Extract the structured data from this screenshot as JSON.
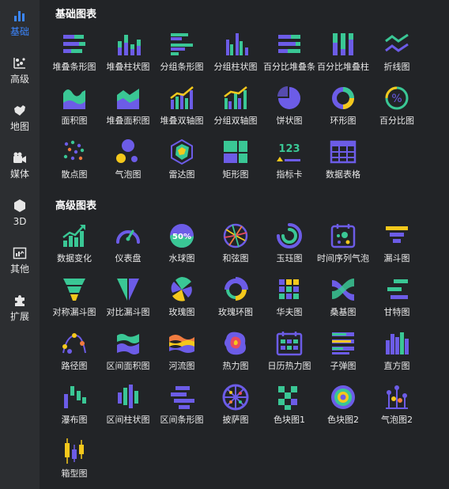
{
  "sidebar": {
    "items": [
      {
        "label": "基础",
        "icon": "bar-chart-icon",
        "active": true
      },
      {
        "label": "高级",
        "icon": "scatter-icon"
      },
      {
        "label": "地图",
        "icon": "map-icon"
      },
      {
        "label": "媒体",
        "icon": "camera-icon"
      },
      {
        "label": "3D",
        "icon": "cube-icon"
      },
      {
        "label": "其他",
        "icon": "image-chart-icon"
      },
      {
        "label": "扩展",
        "icon": "puzzle-icon"
      }
    ]
  },
  "sections": {
    "basic": {
      "title": "基础图表",
      "items": [
        "堆叠条形图",
        "堆叠柱状图",
        "分组条形图",
        "分组柱状图",
        "百分比堆叠条",
        "百分比堆叠柱",
        "折线图",
        "面积图",
        "堆叠面积图",
        "堆叠双轴图",
        "分组双轴图",
        "饼状图",
        "环形图",
        "百分比图",
        "散点图",
        "气泡图",
        "雷达图",
        "矩形图",
        "指标卡",
        "数据表格"
      ]
    },
    "advanced": {
      "title": "高级图表",
      "items": [
        "数据变化",
        "仪表盘",
        "水球图",
        "和弦图",
        "玉珏图",
        "时间序列气泡",
        "漏斗图",
        "对称漏斗图",
        "对比漏斗图",
        "玫瑰图",
        "玫瑰环图",
        "华夫图",
        "桑基图",
        "甘特图",
        "路径图",
        "区间面积图",
        "河流图",
        "热力图",
        "日历热力图",
        "子弹图",
        "直方图",
        "瀑布图",
        "区间柱状图",
        "区间条形图",
        "披萨图",
        "色块图1",
        "色块图2",
        "气泡图2",
        "箱型图"
      ]
    }
  },
  "icon_text": {
    "metric_number": "123",
    "liquid_percent": "50%"
  },
  "colors": {
    "accent": "#3b86ff",
    "green": "#3ac795",
    "purple": "#6c5ce7",
    "yellow": "#f4c81c",
    "bg": "#222427",
    "sidebar_bg": "#2c2e31"
  }
}
